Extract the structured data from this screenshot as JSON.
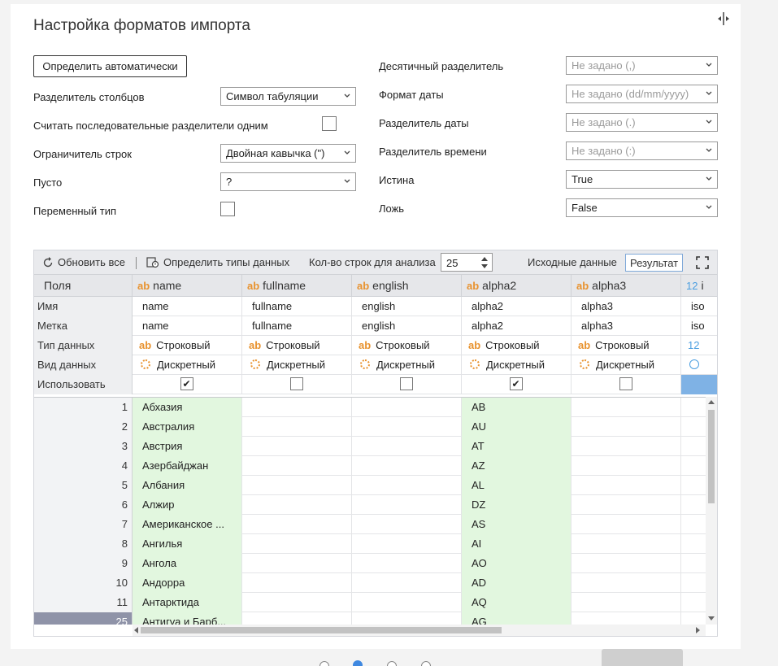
{
  "title": "Настройка форматов импорта",
  "auto_button": "Определить автоматически",
  "left_settings": {
    "col_sep_label": "Разделитель столбцов",
    "col_sep_value": "Символ табуляции",
    "consecutive_label": "Считать последовательные разделители одним",
    "consecutive_checked": false,
    "row_limiter_label": "Ограничитель строк",
    "row_limiter_value": "Двойная кавычка (\")",
    "empty_label": "Пусто",
    "empty_value": "?",
    "variable_type_label": "Переменный тип",
    "variable_type_checked": false
  },
  "right_settings": {
    "decimal_label": "Десятичный разделитель",
    "decimal_value": "Не задано (,)",
    "date_format_label": "Формат даты",
    "date_format_value": "Не задано (dd/mm/yyyy)",
    "date_sep_label": "Разделитель даты",
    "date_sep_value": "Не задано (.)",
    "time_sep_label": "Разделитель времени",
    "time_sep_value": "Не задано (:)",
    "true_label": "Истина",
    "true_value": "True",
    "false_label": "Ложь",
    "false_value": "False"
  },
  "toolbar": {
    "refresh_label": "Обновить все",
    "detect_types_label": "Определить типы данных",
    "rows_label": "Кол-во строк для анализа",
    "rows_value": "25",
    "source_tab": "Исходные данные",
    "result_tab": "Результат"
  },
  "grid": {
    "fields_label": "Поля",
    "meta_labels": [
      "Имя",
      "Метка",
      "Тип данных",
      "Вид данных",
      "Использовать"
    ],
    "columns": [
      {
        "header": "name",
        "type_icon": "ab",
        "name": "name",
        "label": "name",
        "dtype": "Строковый",
        "kind": "Дискретный",
        "use": true
      },
      {
        "header": "fullname",
        "type_icon": "ab",
        "name": "fullname",
        "label": "fullname",
        "dtype": "Строковый",
        "kind": "Дискретный",
        "use": false
      },
      {
        "header": "english",
        "type_icon": "ab",
        "name": "english",
        "label": "english",
        "dtype": "Строковый",
        "kind": "Дискретный",
        "use": false
      },
      {
        "header": "alpha2",
        "type_icon": "ab",
        "name": "alpha2",
        "label": "alpha2",
        "dtype": "Строковый",
        "kind": "Дискретный",
        "use": true
      },
      {
        "header": "alpha3",
        "type_icon": "ab",
        "name": "alpha3",
        "label": "alpha3",
        "dtype": "Строковый",
        "kind": "Дискретный",
        "use": false
      },
      {
        "header": "i",
        "type_icon": "12",
        "name": "iso",
        "label": "iso",
        "dtype": "12",
        "kind": "",
        "use": null
      }
    ],
    "rows": [
      {
        "n": "1",
        "name": "Абхазия",
        "alpha2": "AB"
      },
      {
        "n": "2",
        "name": "Австралия",
        "alpha2": "AU"
      },
      {
        "n": "3",
        "name": "Австрия",
        "alpha2": "AT"
      },
      {
        "n": "4",
        "name": "Азербайджан",
        "alpha2": "AZ"
      },
      {
        "n": "5",
        "name": "Албания",
        "alpha2": "AL"
      },
      {
        "n": "6",
        "name": "Алжир",
        "alpha2": "DZ"
      },
      {
        "n": "7",
        "name": "Американское ...",
        "alpha2": "AS"
      },
      {
        "n": "8",
        "name": "Ангилья",
        "alpha2": "AI"
      },
      {
        "n": "9",
        "name": "Ангола",
        "alpha2": "AO"
      },
      {
        "n": "10",
        "name": "Андорра",
        "alpha2": "AD"
      },
      {
        "n": "11",
        "name": "Антарктида",
        "alpha2": "AQ"
      },
      {
        "n": "25",
        "name": "Антигуа и Барб...",
        "alpha2": "AG"
      }
    ]
  },
  "colors": {
    "accent": "#3f88e0",
    "used_column": "#e2f7df",
    "type_icon": "#e8922e"
  }
}
